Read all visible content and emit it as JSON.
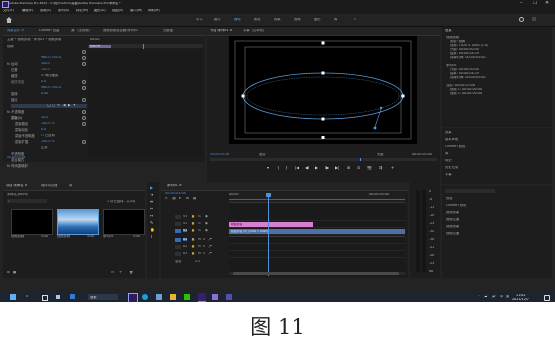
{
  "window": {
    "title": "Adobe Premiere Pro 2022 - C:\\用户\\admin\\桌面\\Adobe Premiere Pro\\未命名 *",
    "menu": [
      "文件(F)",
      "编辑(E)",
      "剪辑(C)",
      "序列(S)",
      "标记(M)",
      "图形(G)",
      "视图(V)",
      "窗口(W)",
      "帮助(H)"
    ],
    "controls": [
      "–",
      "❐",
      "✕"
    ]
  },
  "workspace_tabs": [
    "学习",
    "组件",
    "编辑",
    "颜色",
    "效果",
    "音频",
    "图形",
    "库",
    "»"
  ],
  "effect_controls": {
    "tabs": [
      "效果控件 ≡",
      "Lumetri 范围",
      "源:（无剪辑）",
      "音频剪辑混合器:序列01",
      "元数据"
    ],
    "header": "主要 * 视频剪辑 · 序列01 * 视频剪辑",
    "time": "00:00",
    "clip_label": "视频剪辑",
    "section_video": "视频",
    "rows": [
      {
        "label": "fx 运动",
        "value": ""
      },
      {
        "label": "位置",
        "value": "960.0   540.0"
      },
      {
        "label": "缩放",
        "value": "100.0"
      },
      {
        "label": "缩放宽度",
        "value": "100.0"
      },
      {
        "label": "",
        "value": "☑ 等比缩放"
      },
      {
        "label": "旋转",
        "value": "0.0"
      },
      {
        "label": "锚点",
        "value": "960.0  540.0"
      },
      {
        "label": "防闪烁滤镜",
        "value": "0.00"
      },
      {
        "label": "fx 不透明度",
        "value": ""
      },
      {
        "label": "蒙版(1)",
        "value": ""
      },
      {
        "label": "蒙版路径",
        "value": ""
      },
      {
        "label": "蒙版羽化",
        "value": "10.0"
      },
      {
        "label": "蒙版不透明度",
        "value": "100.0 %"
      },
      {
        "label": "蒙版扩展",
        "value": "0.0"
      },
      {
        "label": "",
        "value": "☐ 已反转"
      },
      {
        "label": "不透明度",
        "value": "100.0 %"
      },
      {
        "label": "混合模式",
        "value": "正常"
      },
      {
        "label": "fx 时间重映射",
        "value": ""
      }
    ],
    "timecode": "00:00:03:08"
  },
  "program_monitor": {
    "tabs": [
      "节目:序列01 ≡",
      "字幕（文本轨）"
    ],
    "timecode_left": "00:00:03:08",
    "fit": "适合",
    "quality": "完整",
    "timecode_right": "00:00:05:00",
    "buttons": [
      "▾",
      "{",
      "}",
      "|◀",
      "◀I",
      "▶",
      "I▶",
      "▶|",
      "⊞",
      "⊡",
      "📷",
      "⇶",
      "+"
    ]
  },
  "info_panel": {
    "title": "信息",
    "lines": [
      "视频剪辑",
      "类型: 视频",
      "视频: 1920 x 1080 (1.0)",
      "开始: 00:00:00:00",
      "结束: 00:00:04:29",
      "持续时间: 00:00:05:00",
      "",
      "序列01",
      "开始: 00:00:00:00",
      "结束: 00:00:04:29",
      "持续时间: 00:00:05:00",
      "",
      "当前: 00:00:03:08",
      "视频 1: 00:00:00:00",
      "视频 2: 00:00:00:00"
    ]
  },
  "right_list": [
    "效果",
    "基本声音",
    "Lumetri 颜色",
    "库",
    "标记",
    "历史记录",
    "字幕",
    "文本",
    "基本图形",
    "Lumetri 范围",
    "元数据",
    "捕捉",
    "事件",
    "项目",
    "工作区"
  ],
  "project_panel": {
    "tabs": [
      "项目:未命名 ≡",
      "媒体浏览器",
      "库"
    ],
    "path": "未命名.prproj",
    "search": "",
    "count": "1 项已选择，共3项",
    "items": [
      {
        "name": "视频剪辑",
        "duration": "5:00"
      },
      {
        "name": "视频剪辑",
        "duration": "5:00"
      },
      {
        "name": "序列01",
        "duration": "5:00"
      }
    ]
  },
  "timeline": {
    "tab": "序列01 ≡",
    "timecode": "00:00:03:08",
    "ruler": [
      "00:00",
      "00:00:05:00"
    ],
    "tracks_video": [
      {
        "name": "V3",
        "label": "V3"
      },
      {
        "name": "V2",
        "label": "V2"
      },
      {
        "name": "V1",
        "label": "V1"
      }
    ],
    "tracks_audio": [
      {
        "name": "A1",
        "label": "A1"
      },
      {
        "name": "A2",
        "label": "A2"
      },
      {
        "name": "A3",
        "label": "A3"
      }
    ],
    "master": "混合",
    "master_value": "0.0",
    "clips": [
      {
        "track": "V2",
        "label": "视频剪辑",
        "color": "#d97fd3"
      },
      {
        "track": "V1",
        "label": "视频剪辑 [V] [1920 x 1080]",
        "color": "#4f6fa8"
      }
    ]
  },
  "meter_scale": [
    "0",
    "-6",
    "-12",
    "-18",
    "-24",
    "-30",
    "-36",
    "-42",
    "-48",
    "-54",
    "dB"
  ],
  "effects_list": [
    "预设",
    "Lumetri 预设",
    "音频效果",
    "音频过渡",
    "视频效果",
    "视频过渡"
  ],
  "taskbar": {
    "search": "搜索",
    "time": "11:02",
    "date": "2021/12/7",
    "tray": [
      "⌃",
      "☁",
      "🔊",
      "中",
      "英"
    ]
  },
  "caption": "图 11",
  "colors": {
    "accent": "#2d8ceb",
    "panel": "#1e1e1e",
    "playhead": "#4d8fd9",
    "mask": "#5b9ad5",
    "clip_pink": "#d97fd3",
    "clip_blue": "#4f6fa8"
  }
}
